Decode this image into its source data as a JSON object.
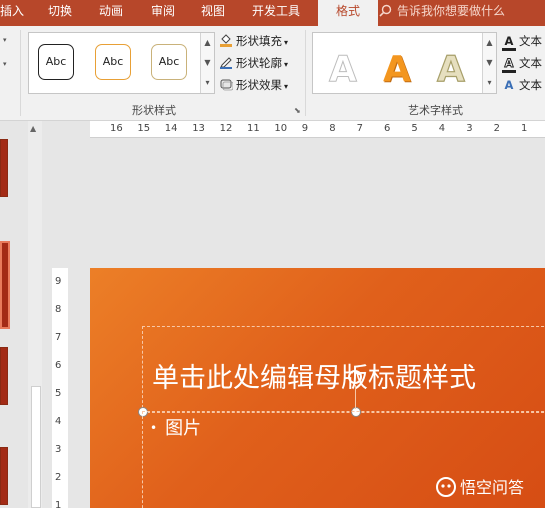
{
  "tabs": {
    "insert": "插入",
    "transitions": "切换",
    "animations": "动画",
    "review": "审阅",
    "view": "视图",
    "developer": "开发工具",
    "format": "格式"
  },
  "tell_me": {
    "placeholder": "告诉我你想要做什么"
  },
  "shape_styles": {
    "label": "形状样式",
    "thumbs": [
      "Abc",
      "Abc",
      "Abc"
    ],
    "fill": "形状填充",
    "outline": "形状轮廓",
    "effects": "形状效果"
  },
  "wordart_styles": {
    "label": "艺术字样式",
    "letters": [
      "A",
      "A",
      "A"
    ],
    "text_fill": "文本",
    "text_outline": "文本",
    "text_effects": "文本"
  },
  "ruler": {
    "horizontal": [
      "16",
      "15",
      "14",
      "13",
      "12",
      "11",
      "10",
      "9",
      "8",
      "7",
      "6",
      "5",
      "4",
      "3",
      "2",
      "1"
    ],
    "vertical": [
      "9",
      "8",
      "7",
      "6",
      "5",
      "4",
      "3",
      "2",
      "1"
    ]
  },
  "slide": {
    "title": "单击此处编辑母版标题样式",
    "bullet": "图片"
  },
  "watermark": {
    "text": "悟空问答"
  },
  "colors": {
    "ribbon_accent": "#b7472a",
    "slide_orange": "#e0601b"
  }
}
